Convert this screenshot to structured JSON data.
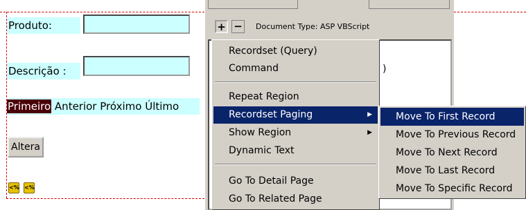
{
  "form": {
    "produto_label": "Produto:",
    "produto_value": "",
    "descricao_label": "Descrição :",
    "descricao_value": "",
    "nav": {
      "first": "Primeiro",
      "previous": "Anterior",
      "next": "Próximo",
      "last": "Último"
    },
    "submit_label": "Altera",
    "asp_icons": [
      "asp-script-icon",
      "asp-script-icon"
    ]
  },
  "panel": {
    "add_label": "+",
    "remove_label": "−",
    "document_type": "Document Type: ASP VBScript",
    "list_fragment": ")"
  },
  "context_menu": {
    "items": [
      {
        "label": "Recordset (Query)"
      },
      {
        "label": "Command"
      },
      {
        "label": "Repeat Region"
      },
      {
        "label": "Recordset Paging",
        "highlighted": true,
        "submenu": true
      },
      {
        "label": "Show Region",
        "submenu": true
      },
      {
        "label": "Dynamic Text"
      },
      {
        "label": "Go To Detail Page"
      },
      {
        "label": "Go To Related Page"
      }
    ],
    "submenu_arrow": "▶"
  },
  "submenu": {
    "items": [
      {
        "label": "Move To First Record",
        "highlighted": true
      },
      {
        "label": "Move To Previous Record"
      },
      {
        "label": "Move To Next Record"
      },
      {
        "label": "Move To Last Record"
      },
      {
        "label": "Move To Specific Record"
      }
    ]
  },
  "colors": {
    "menu_highlight": "#0a246a",
    "cyan_cell": "#ccffff",
    "design_border": "#d40000",
    "nav_first_bg": "#4a0008"
  }
}
